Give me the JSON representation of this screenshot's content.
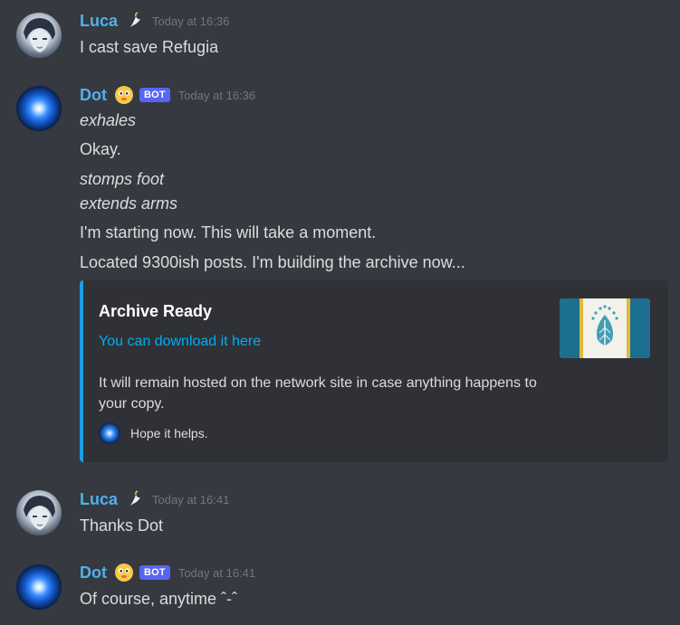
{
  "messages": [
    {
      "author": "Luca",
      "timestamp": "Today at 16:36",
      "lines": [
        "I cast save Refugia"
      ]
    },
    {
      "author": "Dot",
      "bot_tag": "BOT",
      "timestamp": "Today at 16:36",
      "lines": [
        "exhales",
        "Okay.",
        "stomps foot",
        "extends arms",
        "I'm starting now. This will take a moment.",
        "Located 9300ish posts. I'm building the archive now..."
      ],
      "embed": {
        "title": "Archive Ready",
        "link_text": "You can download it here",
        "description": "It will remain hosted on the network site in case anything happens to your copy.",
        "footer": "Hope it helps.",
        "accent_color": "#1e9de6"
      }
    },
    {
      "author": "Luca",
      "timestamp": "Today at 16:41",
      "lines": [
        "Thanks Dot"
      ]
    },
    {
      "author": "Dot",
      "bot_tag": "BOT",
      "timestamp": "Today at 16:41",
      "lines": [
        "Of course, anytime ˆ-ˆ"
      ]
    }
  ],
  "colors": {
    "background": "#36393f",
    "username": "#4fb1ec",
    "bot_badge": "#5865f2",
    "link": "#00aff4",
    "embed_bg": "#2f3136"
  }
}
